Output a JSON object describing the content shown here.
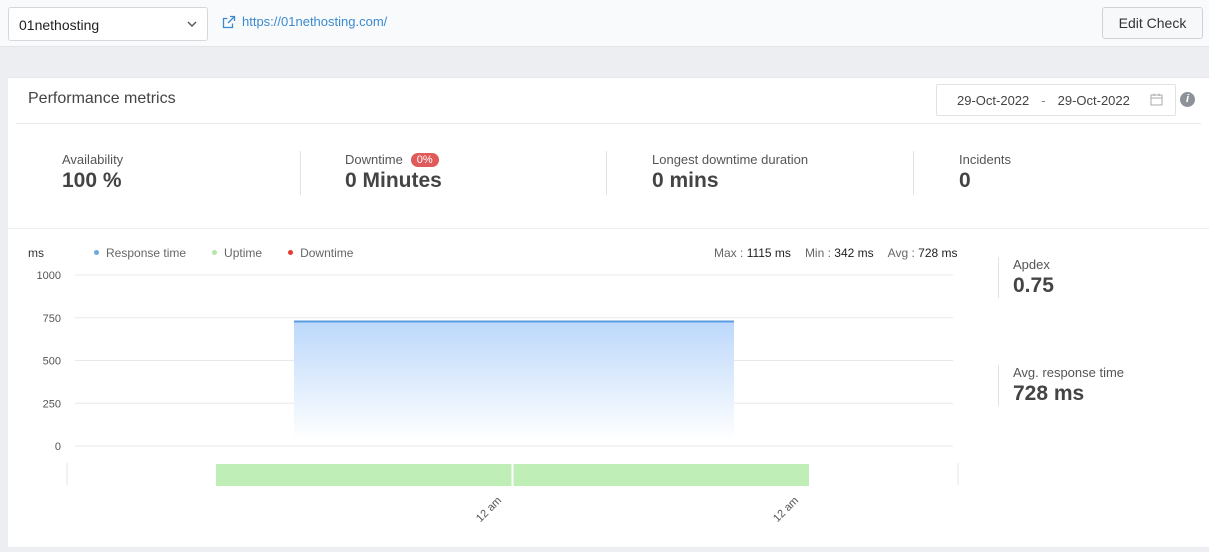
{
  "topbar": {
    "site": "01nethosting",
    "url": "https://01nethosting.com/",
    "edit_label": "Edit Check"
  },
  "panel": {
    "title": "Performance metrics",
    "date_from": "29-Oct-2022",
    "date_sep": "-",
    "date_to": "29-Oct-2022",
    "info_glyph": "i"
  },
  "metrics": [
    {
      "label": "Availability",
      "value": "100 %"
    },
    {
      "label": "Downtime",
      "value": "0 Minutes",
      "badge": "0%"
    },
    {
      "label": "Longest downtime duration",
      "value": "0 mins"
    },
    {
      "label": "Incidents",
      "value": "0"
    }
  ],
  "chart_data": {
    "type": "area",
    "ylabel": "ms",
    "legend": [
      {
        "name": "Response time",
        "color": "#6fa8dc"
      },
      {
        "name": "Uptime",
        "color": "#b7e4a8"
      },
      {
        "name": "Downtime",
        "color": "#e53935"
      }
    ],
    "stats": {
      "max_label": "Max :",
      "max_value": "1115 ms",
      "min_label": "Min :",
      "min_value": "342 ms",
      "avg_label": "Avg :",
      "avg_value": "728 ms"
    },
    "y_ticks": [
      1000,
      750,
      500,
      250,
      0
    ],
    "ylim": [
      0,
      1000
    ],
    "x_ticks": [
      "12 am",
      "12 am"
    ],
    "series": [
      {
        "name": "Response time",
        "values": [
          728,
          728
        ]
      }
    ],
    "uptime_segments": 2,
    "colors": {
      "line": "#5b9bdf",
      "fill_top": "#bcd8fb",
      "uptime": "#bfeeb6"
    }
  },
  "side": {
    "apdex_label": "Apdex",
    "apdex_value": "0.75",
    "avg_label": "Avg. response time",
    "avg_value": "728 ms"
  }
}
